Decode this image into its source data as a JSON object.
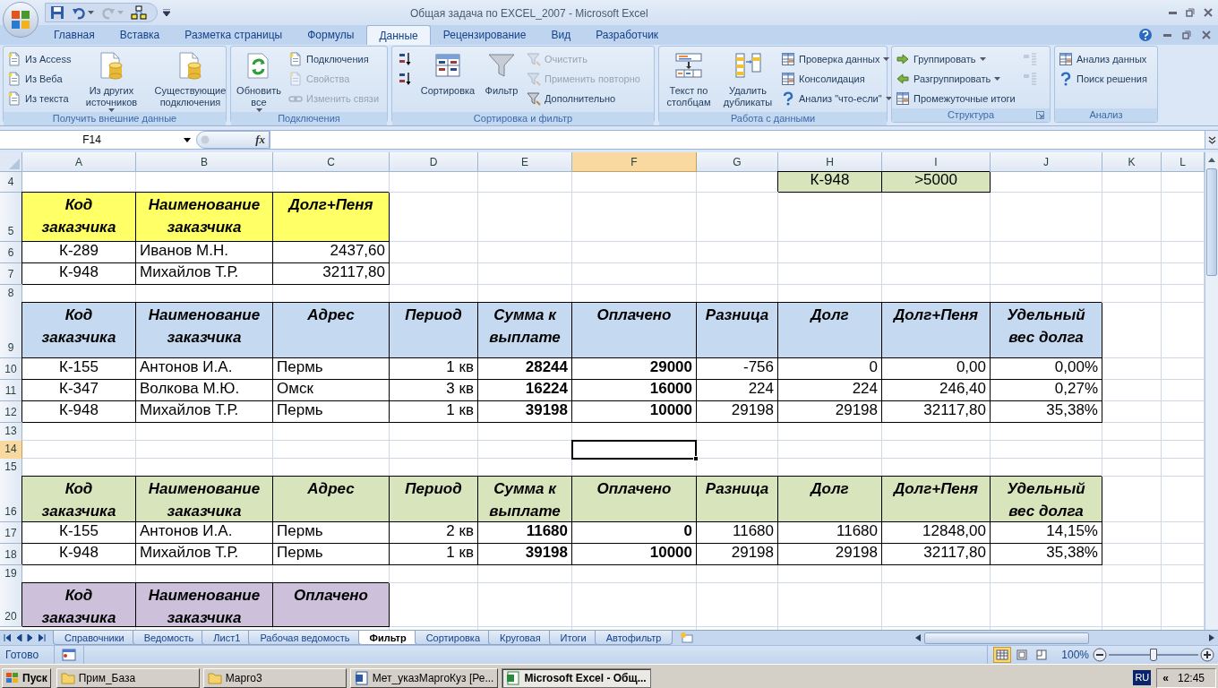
{
  "window": {
    "title": "Общая задача по EXCEL_2007 - Microsoft Excel"
  },
  "quick_access": [
    {
      "kind": "save",
      "disabled": false
    },
    {
      "kind": "undo",
      "disabled": false
    },
    {
      "kind": "redo",
      "disabled": true
    },
    {
      "kind": "diagram",
      "disabled": false
    }
  ],
  "ribbon": {
    "tabs": [
      {
        "label": "Главная",
        "selected": false
      },
      {
        "label": "Вставка",
        "selected": false
      },
      {
        "label": "Разметка страницы",
        "selected": false
      },
      {
        "label": "Формулы",
        "selected": false
      },
      {
        "label": "Данные",
        "selected": true
      },
      {
        "label": "Рецензирование",
        "selected": false
      },
      {
        "label": "Вид",
        "selected": false
      },
      {
        "label": "Разработчик",
        "selected": false
      }
    ],
    "groups": [
      {
        "title": "Получить внешние данные",
        "columns": [
          [
            {
              "label": "Из Access",
              "kind": "small",
              "disabled": false
            },
            {
              "label": "Из Веба",
              "kind": "small",
              "disabled": false
            },
            {
              "label": "Из текста",
              "kind": "small",
              "disabled": false
            }
          ],
          [
            {
              "label": "Из других источников",
              "kind": "large",
              "disabled": false,
              "dropdown": true
            }
          ],
          [
            {
              "label": "Существующие подключения",
              "kind": "large",
              "disabled": false
            }
          ]
        ]
      },
      {
        "title": "Подключения",
        "columns": [
          [
            {
              "label": "Обновить все",
              "kind": "large",
              "disabled": false,
              "dropdown": true
            }
          ],
          [
            {
              "label": "Подключения",
              "kind": "small",
              "disabled": false
            },
            {
              "label": "Свойства",
              "kind": "small",
              "disabled": true
            },
            {
              "label": "Изменить связи",
              "kind": "small",
              "disabled": true
            }
          ]
        ]
      },
      {
        "title": "Сортировка и фильтр",
        "columns": [
          [
            {
              "kind": "icon",
              "disabled": false
            },
            {
              "kind": "icon",
              "disabled": false
            }
          ],
          [
            {
              "label": "Сортировка",
              "kind": "large",
              "disabled": false
            }
          ],
          [
            {
              "label": "Фильтр",
              "kind": "large",
              "disabled": false
            }
          ],
          [
            {
              "label": "Очистить",
              "kind": "small",
              "disabled": true
            },
            {
              "label": "Применить повторно",
              "kind": "small",
              "disabled": true
            },
            {
              "label": "Дополнительно",
              "kind": "small",
              "disabled": false
            }
          ]
        ]
      },
      {
        "title": "Работа с данными",
        "columns": [
          [
            {
              "label": "Текст по столбцам",
              "kind": "large",
              "disabled": false
            }
          ],
          [
            {
              "label": "Удалить дубликаты",
              "kind": "large",
              "disabled": false
            }
          ],
          [
            {
              "label": "Проверка данных",
              "kind": "small",
              "disabled": false,
              "dropdown": true
            },
            {
              "label": "Консолидация",
              "kind": "small",
              "disabled": false
            },
            {
              "label": "Анализ \"что-если\"",
              "kind": "small",
              "disabled": false,
              "dropdown": true
            }
          ]
        ]
      },
      {
        "title": "Структура",
        "dialog_launcher": true,
        "columns": [
          [
            {
              "label": "Группировать",
              "kind": "small",
              "disabled": false,
              "dropdown": true
            },
            {
              "label": "Разгруппировать",
              "kind": "small",
              "disabled": false,
              "dropdown": true
            },
            {
              "label": "Промежуточные итоги",
              "kind": "small",
              "disabled": false
            }
          ],
          [
            {
              "kind": "icon",
              "disabled": true
            },
            {
              "kind": "icon",
              "disabled": true
            }
          ]
        ]
      },
      {
        "title": "Анализ",
        "columns": [
          [
            {
              "label": "Анализ данных",
              "kind": "small",
              "disabled": false
            },
            {
              "label": "Поиск решения",
              "kind": "small",
              "disabled": false
            }
          ]
        ]
      }
    ]
  },
  "formula_bar": {
    "name_box": "F14",
    "function_label": "fx"
  },
  "sheet": {
    "columns": [
      {
        "label": "A",
        "selected": false
      },
      {
        "label": "B",
        "selected": false
      },
      {
        "label": "C",
        "selected": false
      },
      {
        "label": "D",
        "selected": false
      },
      {
        "label": "E",
        "selected": false
      },
      {
        "label": "F",
        "selected": true
      },
      {
        "label": "G",
        "selected": false
      },
      {
        "label": "H",
        "selected": false
      },
      {
        "label": "I",
        "selected": false
      },
      {
        "label": "J",
        "selected": false
      },
      {
        "label": "K",
        "selected": false
      },
      {
        "label": "L",
        "selected": false
      }
    ],
    "rows": [
      {
        "number": "4",
        "selected": false,
        "cells": [
          "",
          "",
          "",
          "",
          "",
          "",
          "",
          {
            "text": "К-948",
            "kind": "code",
            "color": "#d8e4bc"
          },
          {
            "text": ">5000",
            "kind": "code",
            "color": "#d8e4bc"
          }
        ]
      },
      {
        "number": "5",
        "selected": false,
        "cells": [
          {
            "text": "Код заказчика",
            "kind": "header",
            "color": "#ffff66"
          },
          {
            "text": "Наименование заказчика",
            "kind": "header",
            "color": "#ffff66"
          },
          {
            "text": "Долг+Пеня",
            "kind": "header",
            "color": "#ffff66"
          }
        ]
      },
      {
        "number": "6",
        "selected": false,
        "cells": [
          {
            "text": "К-289",
            "kind": "code"
          },
          {
            "text": "Иванов М.Н.",
            "kind": "text"
          },
          {
            "text": "2437,60",
            "kind": "number"
          }
        ]
      },
      {
        "number": "7",
        "selected": false,
        "cells": [
          {
            "text": "К-948",
            "kind": "code"
          },
          {
            "text": "Михайлов Т.Р.",
            "kind": "text"
          },
          {
            "text": "32117,80",
            "kind": "number"
          }
        ]
      },
      {
        "number": "8",
        "selected": false,
        "cells": []
      },
      {
        "number": "9",
        "selected": false,
        "cells": [
          {
            "text": "Код заказчика",
            "kind": "header",
            "color": "#c5d9f1"
          },
          {
            "text": "Наименование заказчика",
            "kind": "header",
            "color": "#c5d9f1"
          },
          {
            "text": "Адрес",
            "kind": "header",
            "color": "#c5d9f1"
          },
          {
            "text": "Период",
            "kind": "header",
            "color": "#c5d9f1"
          },
          {
            "text": "Сумма к выплате",
            "kind": "header",
            "color": "#c5d9f1"
          },
          {
            "text": "Оплачено",
            "kind": "header",
            "color": "#c5d9f1"
          },
          {
            "text": "Разница",
            "kind": "header",
            "color": "#c5d9f1"
          },
          {
            "text": "Долг",
            "kind": "header",
            "color": "#c5d9f1"
          },
          {
            "text": "Долг+Пеня",
            "kind": "header",
            "color": "#c5d9f1"
          },
          {
            "text": "Удельный вес долга",
            "kind": "header",
            "color": "#c5d9f1"
          }
        ]
      },
      {
        "number": "10",
        "selected": false,
        "cells": [
          {
            "text": "К-155",
            "kind": "code"
          },
          {
            "text": "Антонов И.А.",
            "kind": "text"
          },
          {
            "text": "Пермь",
            "kind": "text"
          },
          {
            "text": "1 кв",
            "kind": "number"
          },
          {
            "text": "28244",
            "kind": "number",
            "bold": true
          },
          {
            "text": "29000",
            "kind": "number",
            "bold": true
          },
          {
            "text": "-756",
            "kind": "number"
          },
          {
            "text": "0",
            "kind": "number"
          },
          {
            "text": "0,00",
            "kind": "number"
          },
          {
            "text": "0,00%",
            "kind": "number"
          }
        ]
      },
      {
        "number": "11",
        "selected": false,
        "cells": [
          {
            "text": "К-347",
            "kind": "code"
          },
          {
            "text": "Волкова М.Ю.",
            "kind": "text"
          },
          {
            "text": "Омск",
            "kind": "text"
          },
          {
            "text": "3 кв",
            "kind": "number"
          },
          {
            "text": "16224",
            "kind": "number",
            "bold": true
          },
          {
            "text": "16000",
            "kind": "number",
            "bold": true
          },
          {
            "text": "224",
            "kind": "number"
          },
          {
            "text": "224",
            "kind": "number"
          },
          {
            "text": "246,40",
            "kind": "number"
          },
          {
            "text": "0,27%",
            "kind": "number"
          }
        ]
      },
      {
        "number": "12",
        "selected": false,
        "cells": [
          {
            "text": "К-948",
            "kind": "code"
          },
          {
            "text": "Михайлов Т.Р.",
            "kind": "text"
          },
          {
            "text": "Пермь",
            "kind": "text"
          },
          {
            "text": "1 кв",
            "kind": "number"
          },
          {
            "text": "39198",
            "kind": "number",
            "bold": true
          },
          {
            "text": "10000",
            "kind": "number",
            "bold": true
          },
          {
            "text": "29198",
            "kind": "number"
          },
          {
            "text": "29198",
            "kind": "number"
          },
          {
            "text": "32117,80",
            "kind": "number"
          },
          {
            "text": "35,38%",
            "kind": "number"
          }
        ]
      },
      {
        "number": "13",
        "selected": false,
        "cells": []
      },
      {
        "number": "14",
        "selected": true,
        "cells": [
          "",
          "",
          "",
          "",
          "",
          {
            "selected": true
          }
        ]
      },
      {
        "number": "15",
        "selected": false,
        "cells": []
      },
      {
        "number": "16",
        "selected": false,
        "cells": [
          {
            "text": "Код заказчика",
            "kind": "header",
            "color": "#d8e4bc"
          },
          {
            "text": "Наименование заказчика",
            "kind": "header",
            "color": "#d8e4bc"
          },
          {
            "text": "Адрес",
            "kind": "header",
            "color": "#d8e4bc"
          },
          {
            "text": "Период",
            "kind": "header",
            "color": "#d8e4bc"
          },
          {
            "text": "Сумма к выплате",
            "kind": "header",
            "color": "#d8e4bc"
          },
          {
            "text": "Оплачено",
            "kind": "header",
            "color": "#d8e4bc"
          },
          {
            "text": "Разница",
            "kind": "header",
            "color": "#d8e4bc"
          },
          {
            "text": "Долг",
            "kind": "header",
            "color": "#d8e4bc"
          },
          {
            "text": "Долг+Пеня",
            "kind": "header",
            "color": "#d8e4bc"
          },
          {
            "text": "Удельный вес долга",
            "kind": "header",
            "color": "#d8e4bc"
          }
        ]
      },
      {
        "number": "17",
        "selected": false,
        "cells": [
          {
            "text": "К-155",
            "kind": "code"
          },
          {
            "text": "Антонов И.А.",
            "kind": "text"
          },
          {
            "text": "Пермь",
            "kind": "text"
          },
          {
            "text": "2 кв",
            "kind": "number"
          },
          {
            "text": "11680",
            "kind": "number",
            "bold": true
          },
          {
            "text": "0",
            "kind": "number",
            "bold": true
          },
          {
            "text": "11680",
            "kind": "number"
          },
          {
            "text": "11680",
            "kind": "number"
          },
          {
            "text": "12848,00",
            "kind": "number"
          },
          {
            "text": "14,15%",
            "kind": "number"
          }
        ]
      },
      {
        "number": "18",
        "selected": false,
        "cells": [
          {
            "text": "К-948",
            "kind": "code"
          },
          {
            "text": "Михайлов Т.Р.",
            "kind": "text"
          },
          {
            "text": "Пермь",
            "kind": "text"
          },
          {
            "text": "1 кв",
            "kind": "number"
          },
          {
            "text": "39198",
            "kind": "number",
            "bold": true
          },
          {
            "text": "10000",
            "kind": "number",
            "bold": true
          },
          {
            "text": "29198",
            "kind": "number"
          },
          {
            "text": "29198",
            "kind": "number"
          },
          {
            "text": "32117,80",
            "kind": "number"
          },
          {
            "text": "35,38%",
            "kind": "number"
          }
        ]
      },
      {
        "number": "19",
        "selected": false,
        "cells": []
      },
      {
        "number": "20",
        "selected": false,
        "cells": [
          {
            "text": "Код заказчика",
            "kind": "header",
            "color": "#ccc0da"
          },
          {
            "text": "Наименование заказчика",
            "kind": "header",
            "color": "#ccc0da"
          },
          {
            "text": "Оплачено",
            "kind": "header",
            "color": "#ccc0da"
          }
        ]
      }
    ]
  },
  "sheet_tabs": [
    {
      "label": "Справочники",
      "selected": false
    },
    {
      "label": "Ведомость",
      "selected": false
    },
    {
      "label": "Лист1",
      "selected": false
    },
    {
      "label": "Рабочая ведомость",
      "selected": false
    },
    {
      "label": "Фильтр",
      "selected": true
    },
    {
      "label": "Сортировка",
      "selected": false
    },
    {
      "label": "Круговая",
      "selected": false
    },
    {
      "label": "Итоги",
      "selected": false
    },
    {
      "label": "Автофильтр",
      "selected": false
    }
  ],
  "status_bar": {
    "text": "Готово",
    "views": [
      {
        "kind": "normal",
        "selected": true
      },
      {
        "kind": "page_layout",
        "selected": false
      },
      {
        "kind": "page_break",
        "selected": false
      }
    ],
    "zoom": "100%",
    "zoom_slider": {
      "level": 0.5
    }
  },
  "taskbar": {
    "start": "Пуск",
    "tasks": [
      {
        "label": "Прим_База",
        "kind": "folder",
        "selected": false
      },
      {
        "label": "Марго3",
        "kind": "folder",
        "selected": false
      },
      {
        "label": "Мет_указМаргоКуз [Ре...",
        "kind": "word",
        "selected": false
      },
      {
        "label": "Microsoft Excel - Общ...",
        "kind": "excel",
        "selected": true
      }
    ],
    "language": "RU",
    "tray_toggle": "«",
    "clock": "12:45"
  }
}
